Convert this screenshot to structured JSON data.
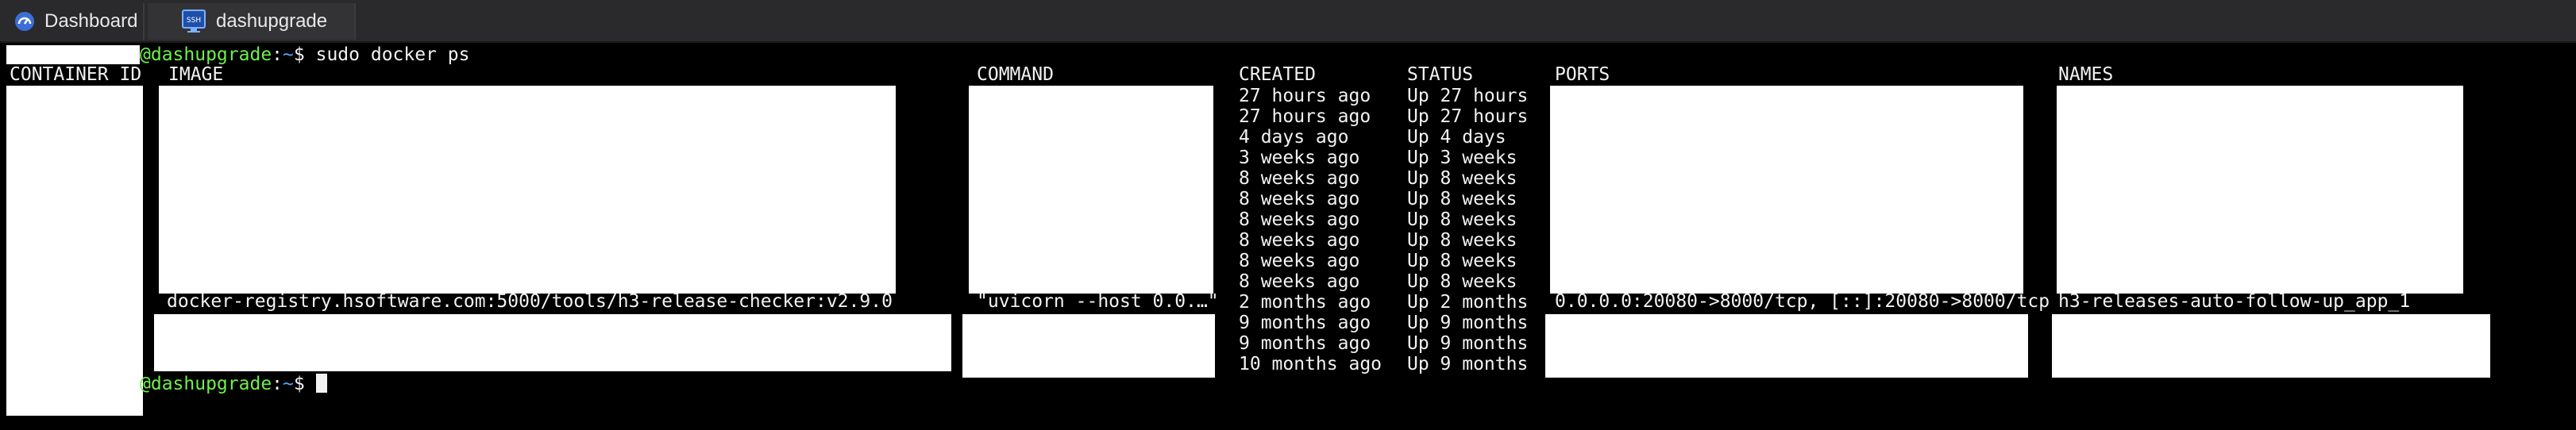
{
  "tabs": [
    {
      "label": "Dashboard",
      "icon": "dashboard-gauge-icon"
    },
    {
      "label": "dashupgrade",
      "icon": "ssh-terminal-icon",
      "icon_text": "SSH"
    }
  ],
  "prompt": {
    "host": "@dashupgrade",
    "separator": ":",
    "path": "~",
    "symbol": "$"
  },
  "command_line": "sudo docker ps",
  "table": {
    "headers": {
      "container_id": "CONTAINER ID",
      "image": "IMAGE",
      "command": "COMMAND",
      "created": "CREATED",
      "status": "STATUS",
      "ports": "PORTS",
      "names": "NAMES"
    },
    "created": [
      "27 hours ago",
      "27 hours ago",
      "4 days ago",
      "3 weeks ago",
      "8 weeks ago",
      "8 weeks ago",
      "8 weeks ago",
      "8 weeks ago",
      "8 weeks ago",
      "8 weeks ago",
      "2 months ago",
      "9 months ago",
      "9 months ago",
      "10 months ago"
    ],
    "status": [
      "Up 27 hours",
      "Up 27 hours",
      "Up 4 days",
      "Up 3 weeks",
      "Up 8 weeks",
      "Up 8 weeks",
      "Up 8 weeks",
      "Up 8 weeks",
      "Up 8 weeks",
      "Up 8 weeks",
      "Up 2 months",
      "Up 9 months",
      "Up 9 months",
      "Up 9 months"
    ],
    "visible_row": {
      "image": "docker-registry.hsoftware.com:5000/tools/h3-release-checker:v2.9.0",
      "command": "\"uvicorn --host 0.0.…\"",
      "ports": "0.0.0.0:20080->8000/tcp, [::]:20080->8000/tcp",
      "names": "h3-releases-auto-follow-up_app_1"
    }
  },
  "colors": {
    "background": "#000000",
    "text": "#f2f2f2",
    "host": "#6ef04a",
    "path": "#4aa8ff",
    "tabbar": "#2a2a2c"
  }
}
